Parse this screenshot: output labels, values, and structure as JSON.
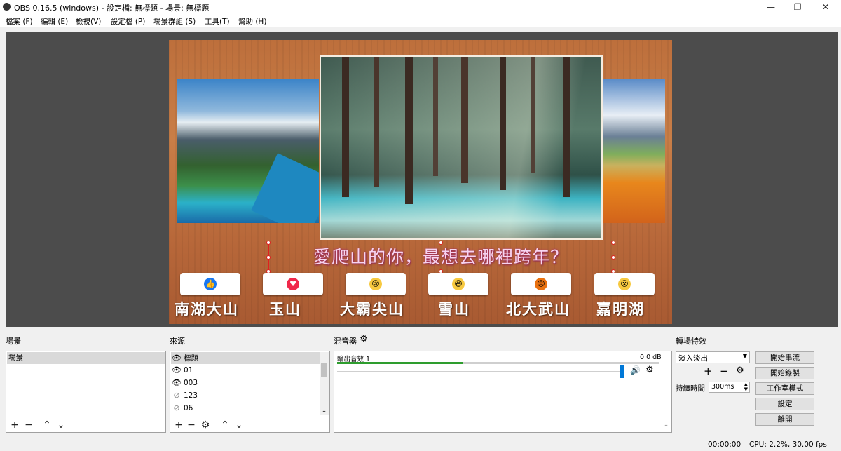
{
  "window": {
    "title": "OBS 0.16.5 (windows) - 設定檔: 無標題 - 場景: 無標題",
    "minimize_glyph": "—",
    "maximize_glyph": "❐",
    "close_glyph": "✕"
  },
  "menu": [
    "檔案 (F)",
    "編輯 (E)",
    "檢視(V)",
    "設定檔 (P)",
    "場景群組 (S)",
    "工具(T)",
    "幫助 (H)"
  ],
  "preview": {
    "question": "愛爬山的你，最想去哪裡跨年？",
    "reactions": [
      {
        "icon": "like-icon",
        "glyph": "👍",
        "color": "#1877f2"
      },
      {
        "icon": "love-icon",
        "glyph": "♥",
        "color": "#f0284a"
      },
      {
        "icon": "sad-icon",
        "glyph": "😢",
        "color": "#f7c940"
      },
      {
        "icon": "haha-icon",
        "glyph": "😆",
        "color": "#f7c940"
      },
      {
        "icon": "angry-icon",
        "glyph": "😠",
        "color": "#e9710f"
      },
      {
        "icon": "wow-icon",
        "glyph": "😮",
        "color": "#f7c940"
      }
    ],
    "options": [
      "南湖大山",
      "玉山",
      "大霸尖山",
      "雪山",
      "北大武山",
      "嘉明湖"
    ]
  },
  "scenes": {
    "title": "場景",
    "items": [
      "場景"
    ]
  },
  "sources": {
    "title": "來源",
    "items": [
      {
        "name": "標題",
        "visible": true
      },
      {
        "name": "01",
        "visible": true
      },
      {
        "name": "003",
        "visible": true
      },
      {
        "name": "123",
        "visible": false
      },
      {
        "name": "06",
        "visible": false
      }
    ]
  },
  "mixer": {
    "title": "混音器",
    "channel_name": "輸出音效 1",
    "level": "0.0 dB",
    "level_fill": 0.39,
    "volume": 1.0
  },
  "transitions": {
    "title": "轉場特效",
    "selected": "淡入淡出",
    "duration_label": "持續時間",
    "duration_value": "300ms"
  },
  "controls": {
    "start_streaming": "開始串流",
    "start_recording": "開始錄製",
    "studio_mode": "工作室模式",
    "settings": "設定",
    "exit": "離開"
  },
  "status": {
    "time": "00:00:00",
    "cpu": "CPU: 2.2%, 30.00 fps"
  },
  "colors": {
    "accent": "#0078d7",
    "selection_border": "#e02020",
    "mixer_green": "#2e9d2e"
  }
}
